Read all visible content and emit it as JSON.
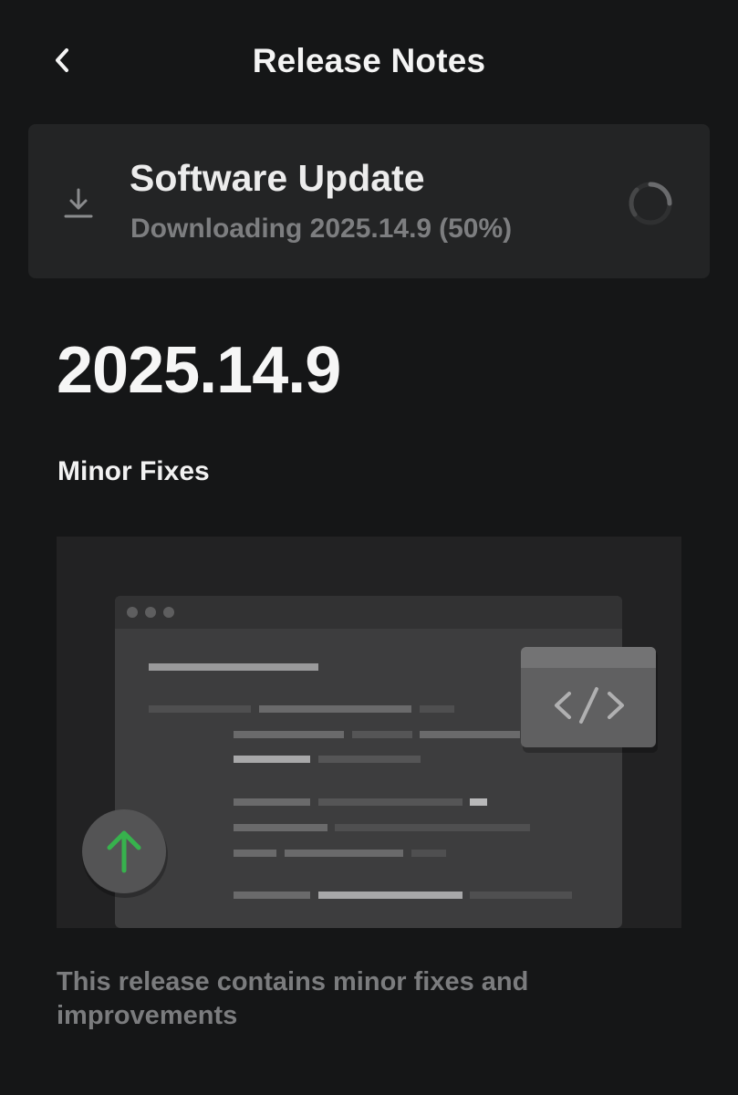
{
  "header": {
    "title": "Release Notes",
    "back_icon": "chevron-left-icon"
  },
  "update_card": {
    "icon": "download-icon",
    "title": "Software Update",
    "status_prefix": "Downloading 2025.14.9",
    "status_percent": "(50%)",
    "progress": 0.5,
    "spinner_icon": "loading-spinner-icon"
  },
  "release": {
    "version": "2025.14.9",
    "subtitle": "Minor Fixes",
    "description": "This release contains minor fixes and improvements"
  },
  "illustration": {
    "code_icon": "code-icon",
    "upload_icon": "arrow-up-icon",
    "accent_color": "#37b24d"
  },
  "colors": {
    "background": "#151617",
    "card": "#232425",
    "text_primary": "#f4f4f4",
    "text_secondary": "#7d7e80"
  }
}
